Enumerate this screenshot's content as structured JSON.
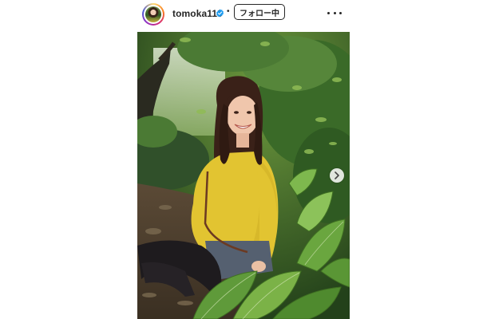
{
  "post": {
    "username": "tomoka119",
    "separator": "•",
    "follow_label": "フォロー中",
    "more_icon": "more-horizontal-icon",
    "verified_icon": "verified-badge-icon",
    "next_icon": "chevron-right-icon",
    "image_alt": "Woman in a yellow knit top sitting among green leaves in a forest"
  },
  "colors": {
    "verified": "#1d9bf0",
    "top_yellow": "#e2c431",
    "foliage": "#3f6f2a"
  }
}
